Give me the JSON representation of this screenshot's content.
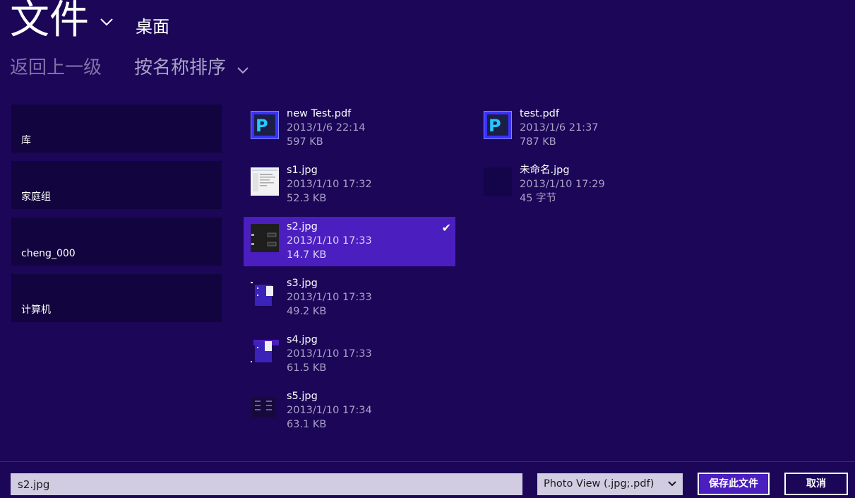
{
  "header": {
    "title": "文件",
    "location": "桌面",
    "nav_up": "返回上一级",
    "sort_label": "按名称排序"
  },
  "sidebar": {
    "items": [
      {
        "label": "库"
      },
      {
        "label": "家庭组"
      },
      {
        "label": "cheng_000"
      },
      {
        "label": "计算机"
      }
    ]
  },
  "files": [
    {
      "name": "new Test.pdf",
      "date": "2013/1/6 22:14",
      "size": "597 KB",
      "icon": "pdf-icon"
    },
    {
      "name": "test.pdf",
      "date": "2013/1/6 21:37",
      "size": "787 KB",
      "icon": "pdf-icon"
    },
    {
      "name": "s1.jpg",
      "date": "2013/1/10 17:32",
      "size": "52.3 KB",
      "icon": "image-thumbnail"
    },
    {
      "name": "未命名.jpg",
      "date": "2013/1/10 17:29",
      "size": "45 字节",
      "icon": "image-thumbnail"
    },
    {
      "name": "s2.jpg",
      "date": "2013/1/10 17:33",
      "size": "14.7 KB",
      "icon": "image-thumbnail",
      "selected": true
    },
    {
      "name": "s3.jpg",
      "date": "2013/1/10 17:33",
      "size": "49.2 KB",
      "icon": "image-thumbnail"
    },
    {
      "name": "s4.jpg",
      "date": "2013/1/10 17:33",
      "size": "61.5 KB",
      "icon": "image-thumbnail"
    },
    {
      "name": "s5.jpg",
      "date": "2013/1/10 17:34",
      "size": "63.1 KB",
      "icon": "image-thumbnail"
    }
  ],
  "footer": {
    "filename_value": "s2.jpg",
    "file_type": "Photo View (.jpg;.pdf)",
    "save_label": "保存此文件",
    "cancel_label": "取消"
  },
  "colors": {
    "background": "#1b0658",
    "selection": "#4b1ec0",
    "tile": "#12043e",
    "secondary_text": "#a9a2c6"
  }
}
